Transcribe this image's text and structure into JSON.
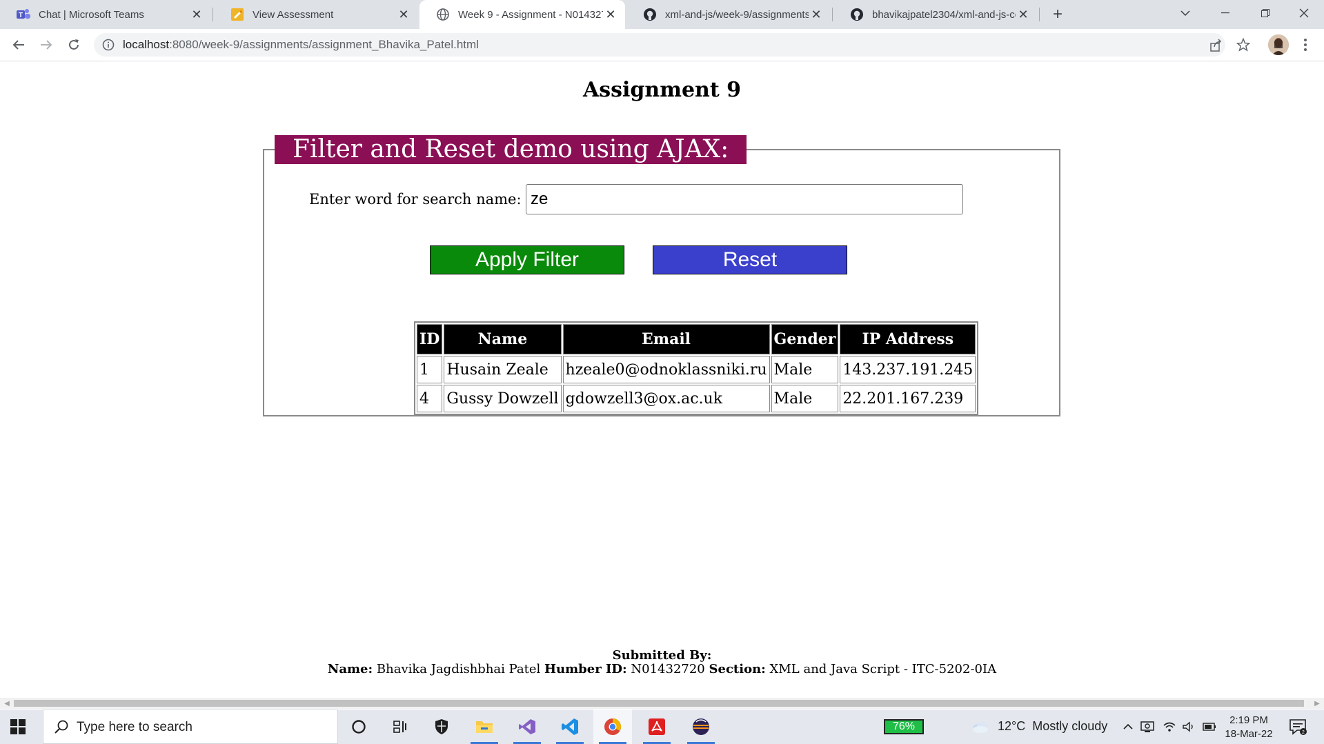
{
  "browser": {
    "tabs": [
      {
        "title": "Chat | Microsoft Teams",
        "icon": "teams-icon"
      },
      {
        "title": "View Assessment",
        "icon": "assessment-icon"
      },
      {
        "title": "Week 9 - Assignment - N014327",
        "icon": "globe-icon",
        "active": true
      },
      {
        "title": "xml-and-js/week-9/assignments",
        "icon": "github-icon"
      },
      {
        "title": "bhavikajpatel2304/xml-and-js-co",
        "icon": "github-icon"
      }
    ],
    "url_host": "localhost",
    "url_path": ":8080/week-9/assignments/assignment_Bhavika_Patel.html"
  },
  "page": {
    "title": "Assignment 9",
    "legend": "Filter and Reset demo using AJAX:",
    "search_label": "Enter word for search name:",
    "search_value": "ze",
    "apply_label": "Apply Filter",
    "reset_label": "Reset",
    "colors": {
      "legend_bg": "#8b0f55",
      "apply_bg": "#0a8a0a",
      "reset_bg": "#3a3fcc"
    },
    "table": {
      "headers": [
        "ID",
        "Name",
        "Email",
        "Gender",
        "IP Address"
      ],
      "rows": [
        [
          "1",
          "Husain Zeale",
          "hzeale0@odnoklassniki.ru",
          "Male",
          "143.237.191.245"
        ],
        [
          "4",
          "Gussy Dowzell",
          "gdowzell3@ox.ac.uk",
          "Male",
          "22.201.167.239"
        ]
      ]
    },
    "footer": {
      "submitted_by": "Submitted By:",
      "name_label": "Name:",
      "name_value": "Bhavika Jagdishbhai Patel",
      "humber_label": "Humber ID:",
      "humber_value": "N01432720",
      "section_label": "Section:",
      "section_value": "XML and Java Script - ITC-5202-0IA"
    }
  },
  "taskbar": {
    "search_placeholder": "Type here to search",
    "battery": "76%",
    "weather_temp": "12°C",
    "weather_desc": "Mostly cloudy",
    "time": "2:19 PM",
    "date": "18-Mar-22"
  }
}
